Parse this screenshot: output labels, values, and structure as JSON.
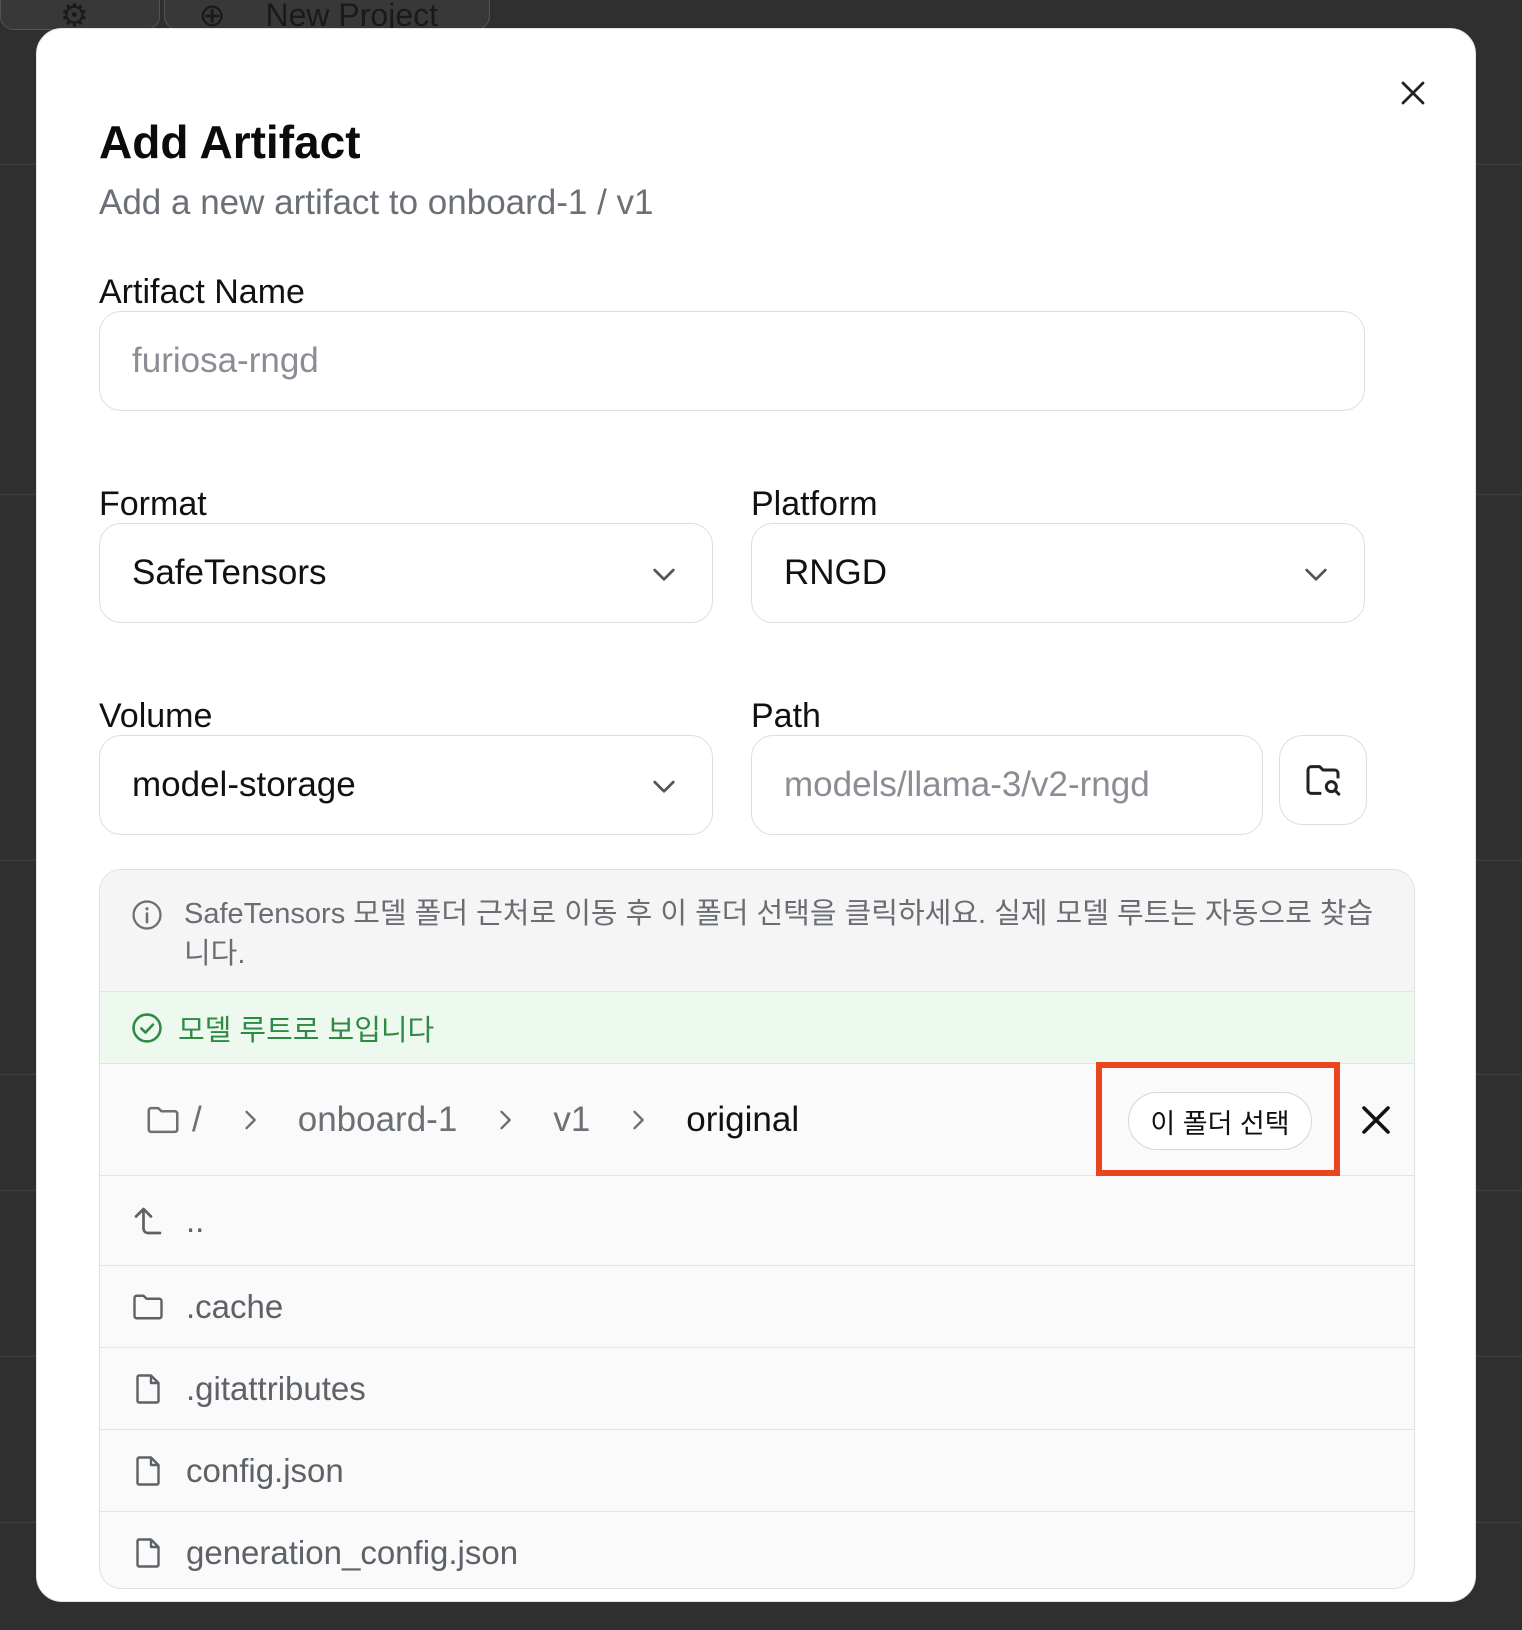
{
  "background": {
    "topbar_new_project": "New Project"
  },
  "modal": {
    "title": "Add Artifact",
    "subtitle": "Add a new artifact to onboard-1 / v1",
    "close_icon": "close-icon"
  },
  "form": {
    "artifact_name_label": "Artifact Name",
    "artifact_name_placeholder": "furiosa-rngd",
    "format_label": "Format",
    "format_value": "SafeTensors",
    "platform_label": "Platform",
    "platform_value": "RNGD",
    "volume_label": "Volume",
    "volume_value": "model-storage",
    "path_label": "Path",
    "path_placeholder": "models/llama-3/v2-rngd",
    "browse_icon": "folder-search-icon"
  },
  "browser": {
    "info_text": "SafeTensors 모델 폴더 근처로 이동 후 이 폴더 선택을 클릭하세요. 실제 모델 루트는 자동으로 찾습니다.",
    "success_text": "모델 루트로 보입니다",
    "breadcrumb": [
      "/",
      "onboard-1",
      "v1",
      "original"
    ],
    "select_folder_label": "이 폴더 선택",
    "up_label": "..",
    "items": [
      {
        "name": ".cache",
        "type": "folder"
      },
      {
        "name": ".gitattributes",
        "type": "file"
      },
      {
        "name": "config.json",
        "type": "file"
      },
      {
        "name": "generation_config.json",
        "type": "file"
      }
    ]
  },
  "colors": {
    "highlight": "#e8461f",
    "success": "#2f8a43"
  }
}
